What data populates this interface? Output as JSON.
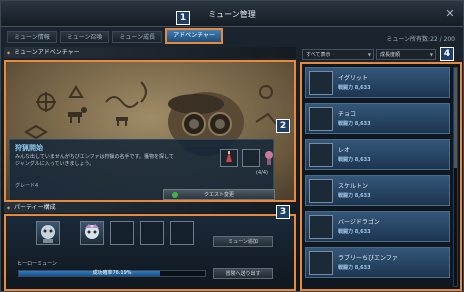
{
  "window": {
    "title": "ミューン管理",
    "close_glyph": "✕"
  },
  "tabs": [
    {
      "label": "ミューン情報"
    },
    {
      "label": "ミューン召喚"
    },
    {
      "label": "ミューン成長"
    },
    {
      "label": "アドベンチャー",
      "active": true
    }
  ],
  "owned_count": "ミューン所有数:22 / 200",
  "markers": [
    "1",
    "2",
    "3",
    "4"
  ],
  "adventure": {
    "header": "ミューンアドベンチャー",
    "hunt_title": "狩猟開始",
    "hunt_desc": "みんな出していませんがちびエンファは狩猟の名手です。獲物を探してジャングルに入っていきましょう。",
    "grade": "グレード4",
    "count": "(4/4)",
    "quest_button": "クエスト変更"
  },
  "party": {
    "header": "パーティー構成",
    "hero_label": "ヒーローミューン",
    "recommend_button": "ミューン追加",
    "dispatch_button": "冒険へ送り出す",
    "success_rate": "成功確率76.19%",
    "success_fraction": 0.76
  },
  "filters": {
    "sort": "すべて表示",
    "order": "成長度順"
  },
  "mune_list": [
    {
      "name": "イグリット",
      "power": "戦闘力 8,633"
    },
    {
      "name": "チョコ",
      "power": "戦闘力 8,633"
    },
    {
      "name": "レオ",
      "power": "戦闘力 8,633"
    },
    {
      "name": "スケルトン",
      "power": "戦闘力 8,633"
    },
    {
      "name": "バージドラゴン",
      "power": "戦闘力 8,633"
    },
    {
      "name": "ラブリーちびエンファ",
      "power": "戦闘力 8,633"
    }
  ],
  "colors": {
    "accent": "#e8893e",
    "marker_bg": "#1d3e66",
    "card_bg": "#34577a"
  }
}
